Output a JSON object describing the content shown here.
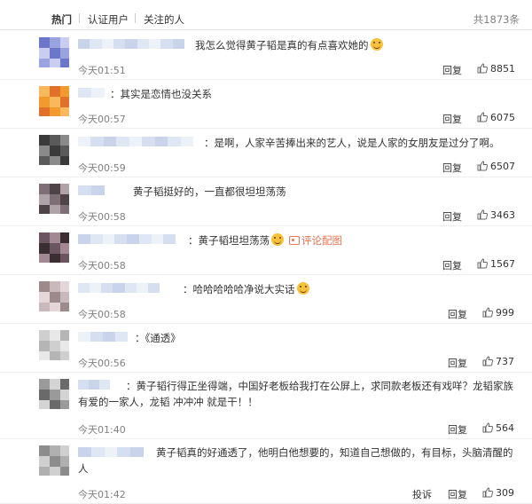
{
  "tabs": [
    {
      "label": "热门",
      "active": true
    },
    {
      "label": "认证用户",
      "active": false
    },
    {
      "label": "关注的人",
      "active": false
    }
  ],
  "total": "共1873条",
  "reply_label": "回复",
  "report_label": "投诉",
  "comments": [
    {
      "text": "我怎么觉得黄子韬是真的有点喜欢她的",
      "emoji_end": "laugh-emoji",
      "time": "今天01:51",
      "likes": "8851"
    },
    {
      "text": "：其实是恋情也没关系",
      "time": "今天00:57",
      "likes": "6075"
    },
    {
      "text": "：是啊，人家辛苦捧出来的艺人，说是人家的女朋友是过分了啊。",
      "time": "今天00:59",
      "likes": "6507"
    },
    {
      "text": "黄子韬挺好的，一直都很坦坦荡荡",
      "time": "今天00:58",
      "likes": "3463"
    },
    {
      "text": "：黄子韬坦坦荡荡",
      "emoji_mid": "teary-laugh-emoji",
      "link": "评论配图",
      "time": "今天00:58",
      "likes": "1567"
    },
    {
      "text": "：哈哈哈哈哈净说大实话",
      "emoji_end": "laugh-emoji",
      "time": "今天00:58",
      "likes": "999"
    },
    {
      "text": "：《通透》",
      "time": "今天00:56",
      "likes": "737"
    },
    {
      "text": "：黄子韬行得正坐得端，中国好老板给我打在公屏上，求同款老板还有戏咩？龙韬家族有爱的一家人，龙韬 冲冲冲 就是干！！",
      "time": "今天01:40",
      "likes": "564"
    },
    {
      "text": "黄子韬真的好通透了，他明白他想要的，知道自己想做的，有目标，头脑清醒的人",
      "time": "今天01:42",
      "likes": "309",
      "show_report": true
    }
  ],
  "colors": {
    "link": "#eb7350",
    "muted": "#808080",
    "text": "#333333",
    "divider": "#eeeeee"
  }
}
